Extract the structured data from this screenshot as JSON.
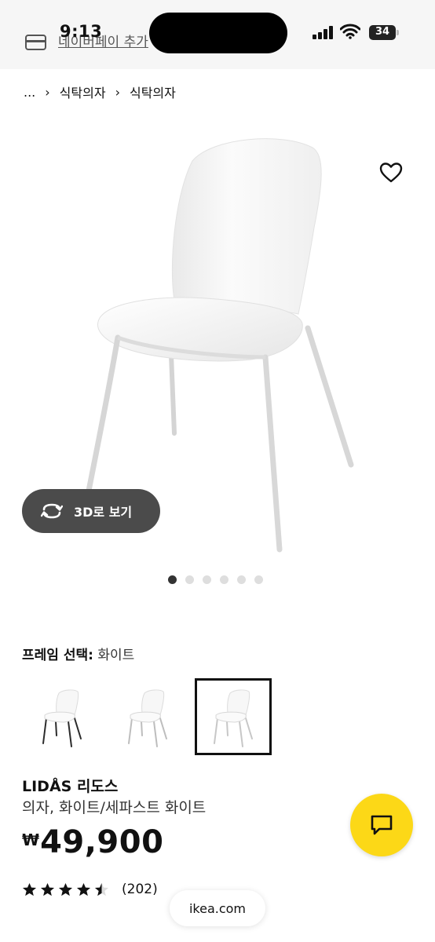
{
  "status_bar": {
    "time": "9:13",
    "battery": "34",
    "naverpay_link": "네이버페이 추가"
  },
  "breadcrumb": {
    "ellipsis": "...",
    "items": [
      "식탁의자",
      "식탁의자"
    ]
  },
  "gallery": {
    "view_3d_label": "3D로 보기",
    "dot_count": 6,
    "active_index": 0
  },
  "frame": {
    "label": "프레임 선택:",
    "value": "화이트",
    "variants": [
      {
        "name": "black-frame",
        "color": "#2b2b2b",
        "selected": false
      },
      {
        "name": "white-frame-1",
        "color": "#bdbdbd",
        "selected": false
      },
      {
        "name": "white-frame-2",
        "color": "#c7c7c7",
        "selected": true
      }
    ]
  },
  "product": {
    "name": "LIDÅS 리도스",
    "description": "의자, 화이트/세파스트 화이트",
    "currency": "₩",
    "price": "49,900",
    "rating": 4.5,
    "review_count": "(202)"
  },
  "browser": {
    "url": "ikea.com"
  },
  "colors": {
    "chat_button": "#fcd817",
    "dark_pill": "#4b4b4b"
  }
}
